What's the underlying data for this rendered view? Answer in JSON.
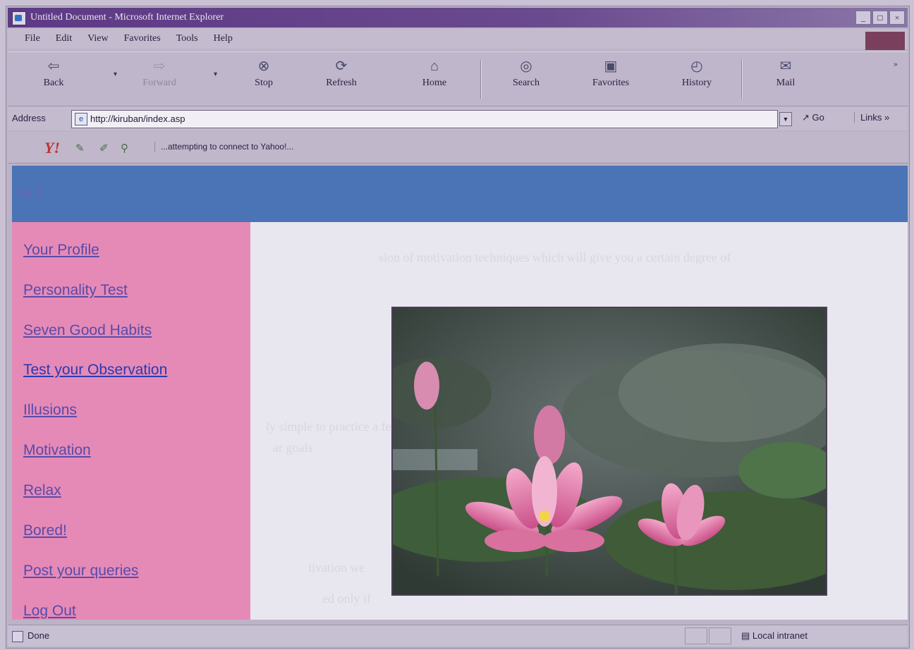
{
  "window": {
    "title": "Untitled Document - Microsoft Internet Explorer",
    "controls": [
      "_",
      "□",
      "×"
    ]
  },
  "menu": [
    "File",
    "Edit",
    "View",
    "Favorites",
    "Tools",
    "Help"
  ],
  "toolbar": {
    "back": "Back",
    "forward": "Forward",
    "stop": "Stop",
    "refresh": "Refresh",
    "home": "Home",
    "search": "Search",
    "favorites": "Favorites",
    "history": "History",
    "mail": "Mail",
    "more": "»"
  },
  "address": {
    "label": "Address",
    "url": "http://kiruban/index.asp",
    "go": "Go",
    "links": "Links »"
  },
  "yahoo": {
    "logo": "Y!",
    "status": "...attempting to connect to Yahoo!..."
  },
  "page": {
    "greeting": "Hi !,",
    "nav": [
      "Your Profile",
      "Personality Test",
      "Seven Good Habits",
      "Test your Observation",
      "Illusions",
      "Motivation",
      "Relax",
      "Bored!",
      "Post your queries",
      "Log Out"
    ],
    "photo_subject": "pink lotus flowers among lily pads",
    "faint_text": [
      "sion of motivation techniques which will give you a certain degree of",
      "ly simple to practice a few of",
      "ar goals",
      "tivation we",
      "ed only if"
    ]
  },
  "status": {
    "left": "Done",
    "zone": "Local intranet"
  }
}
